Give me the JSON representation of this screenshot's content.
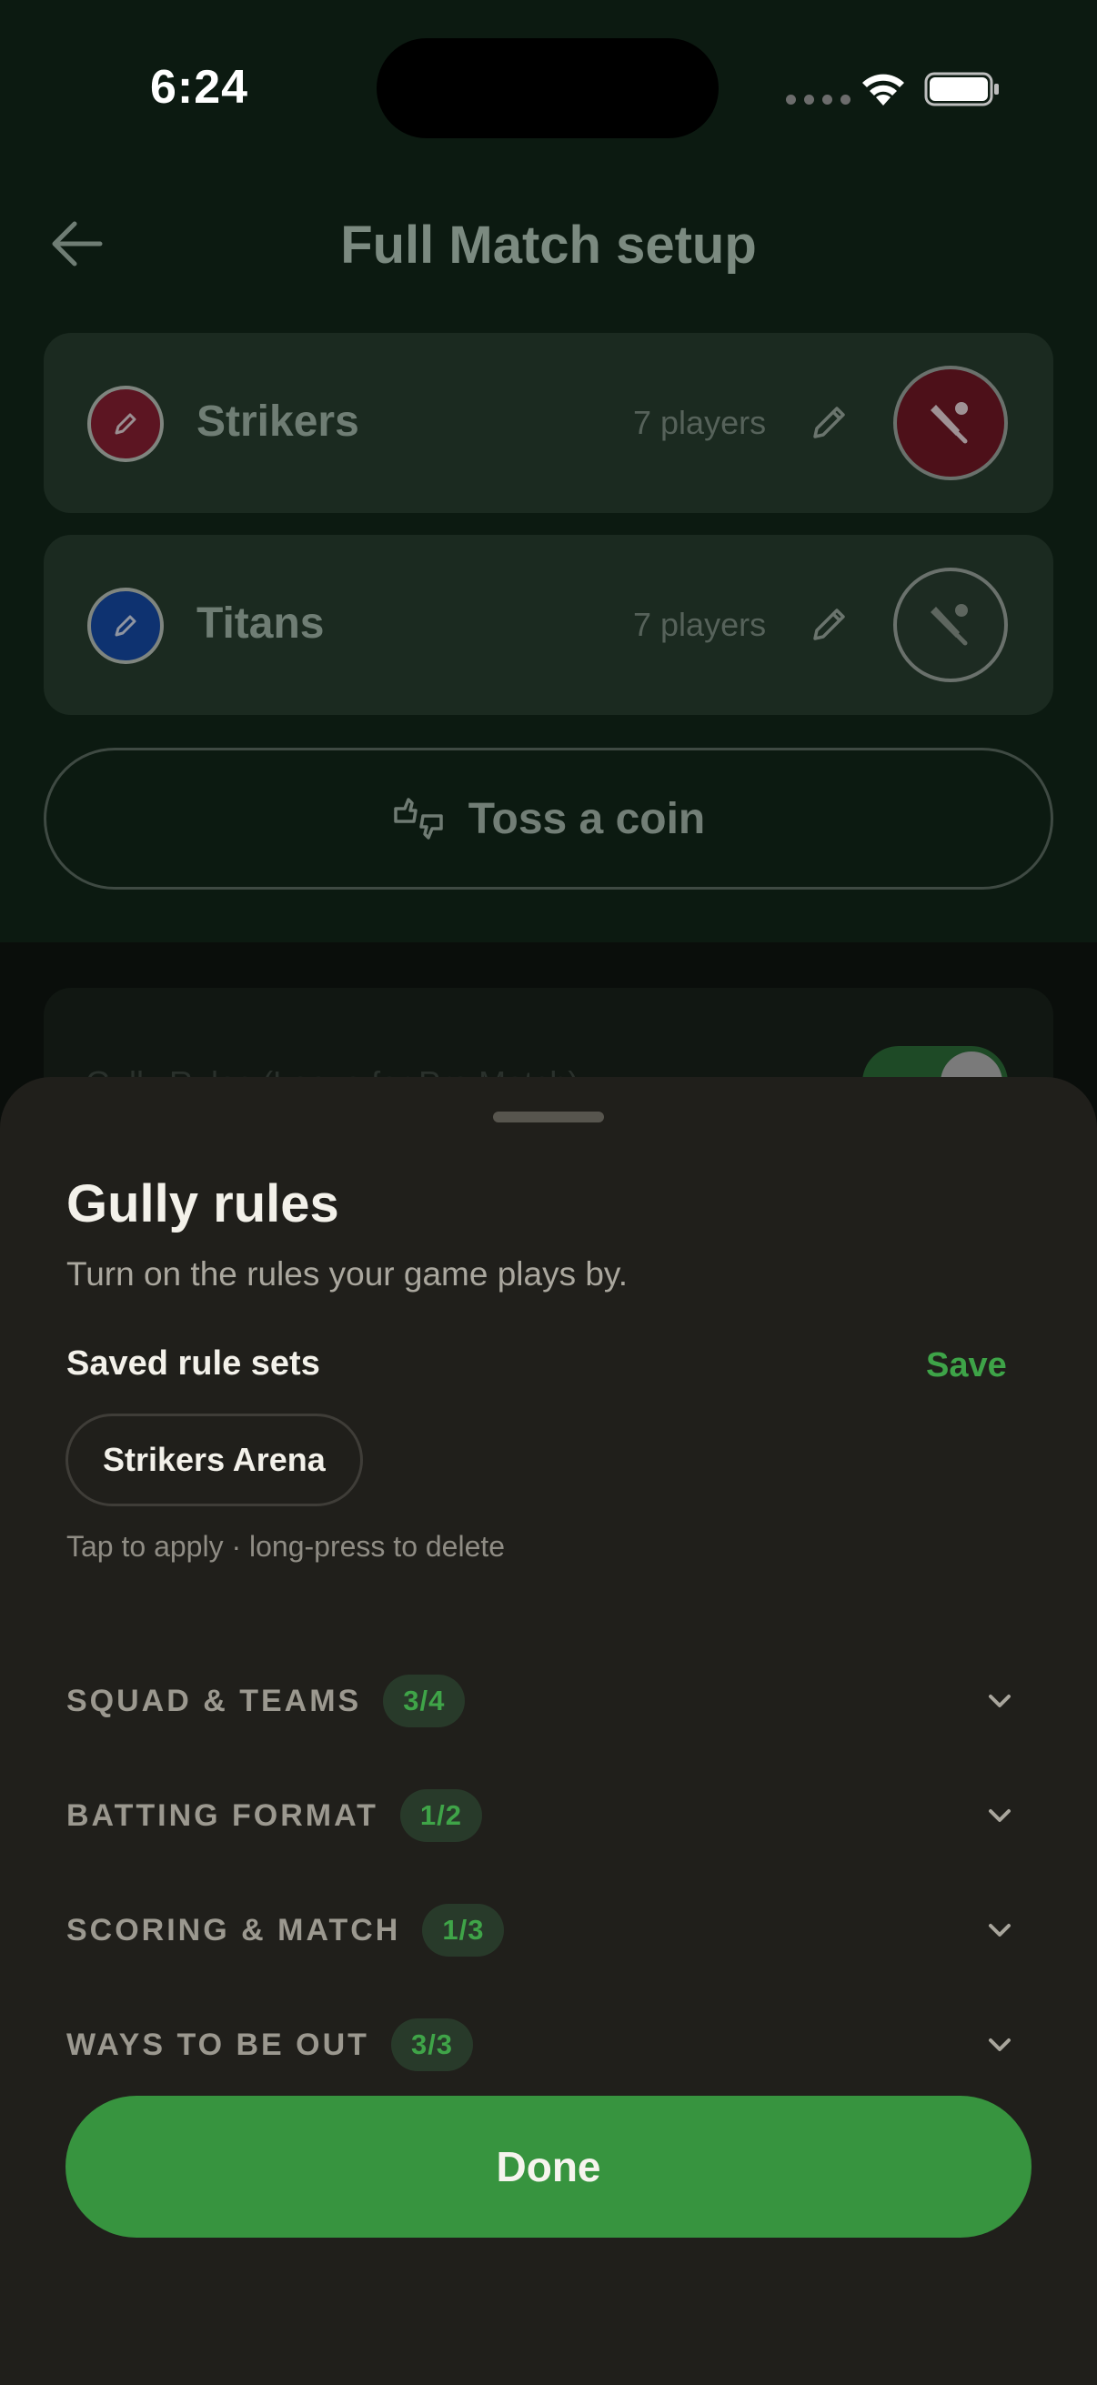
{
  "status_bar": {
    "time": "6:24"
  },
  "header": {
    "title": "Full Match setup"
  },
  "teams": [
    {
      "name": "Strikers",
      "players": "7 players",
      "color": "#5c1522"
    },
    {
      "name": "Titans",
      "players": "7 players",
      "color": "#0e3270"
    }
  ],
  "toss": {
    "label": "Toss a coin"
  },
  "rules_card": {
    "label": "Gully Rules (Leave for Pro Match)"
  },
  "sheet": {
    "title": "Gully rules",
    "subtitle": "Turn on the rules your game plays by.",
    "saved_label": "Saved rule sets",
    "save_label": "Save",
    "ruleset_chip": "Strikers Arena",
    "hint": "Tap to apply · long-press to delete",
    "sections": [
      {
        "label": "SQUAD & TEAMS",
        "badge": "3/4"
      },
      {
        "label": "BATTING FORMAT",
        "badge": "1/2"
      },
      {
        "label": "SCORING & MATCH",
        "badge": "1/3"
      },
      {
        "label": "WAYS TO BE OUT",
        "badge": "3/3"
      }
    ],
    "done_label": "Done"
  },
  "colors": {
    "accent": "#37943f",
    "sheet_bg": "#201f1b",
    "badge_text": "#3fa448"
  }
}
